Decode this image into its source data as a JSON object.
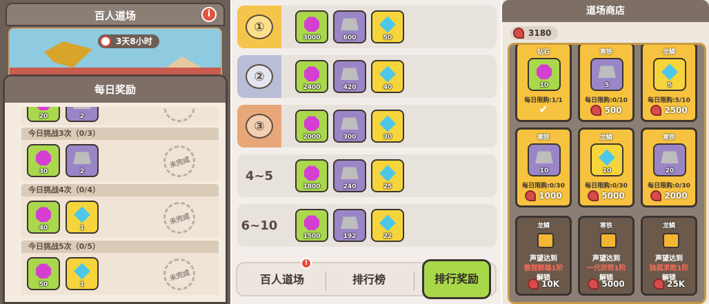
{
  "panel1": {
    "title": "百人道场",
    "info_glyph": "i",
    "timer": "3天8小时",
    "dialog_title": "每日奖励",
    "partial_row": {
      "items": [
        {
          "type": "gem",
          "qty": "20"
        },
        {
          "type": "ingot",
          "qty": "2"
        }
      ]
    },
    "tasks": [
      {
        "label": "今日挑战3次（0/3）",
        "status": "未完成",
        "items": [
          {
            "type": "gem",
            "qty": "30"
          },
          {
            "type": "ingot",
            "qty": "2"
          }
        ]
      },
      {
        "label": "今日挑战4次（0/4）",
        "status": "未完成",
        "items": [
          {
            "type": "gem",
            "qty": "40"
          },
          {
            "type": "scale",
            "qty": "1"
          }
        ]
      },
      {
        "label": "今日挑战5次（0/5）",
        "status": "未完成",
        "items": [
          {
            "type": "gem",
            "qty": "50"
          },
          {
            "type": "scale",
            "qty": "1"
          }
        ]
      }
    ]
  },
  "panel2": {
    "ranks": [
      {
        "rank": "①",
        "badge_color": "#f4c54b",
        "items": [
          "3000",
          "600",
          "50"
        ]
      },
      {
        "rank": "②",
        "badge_color": "#b9bdd6",
        "items": [
          "2400",
          "420",
          "40"
        ]
      },
      {
        "rank": "③",
        "badge_color": "#e7a779",
        "items": [
          "2000",
          "300",
          "30"
        ]
      },
      {
        "rank": "4~5",
        "badge_color": "#e8e2dd",
        "items": [
          "1800",
          "240",
          "25"
        ]
      },
      {
        "rank": "6~10",
        "badge_color": "#e8e2dd",
        "items": [
          "1500",
          "192",
          "22"
        ]
      }
    ],
    "tabs": [
      {
        "label": "百人道场",
        "active": false,
        "alert": "!"
      },
      {
        "label": "排行榜",
        "active": false
      },
      {
        "label": "排行奖励",
        "active": true
      }
    ]
  },
  "panel3": {
    "title": "道场商店",
    "currency": "3180",
    "cards": [
      {
        "name": "钻石",
        "item": "gem",
        "qty": "10",
        "limit": "每日限购:1/1",
        "price": "",
        "sold_out": true
      },
      {
        "name": "寒铁",
        "item": "ingot",
        "qty": "5",
        "limit": "每日限购:0/10",
        "price": "500"
      },
      {
        "name": "龙鳞",
        "item": "scale",
        "qty": "5",
        "limit": "每日限购:5/10",
        "price": "2500"
      },
      {
        "name": "寒铁",
        "item": "ingot",
        "qty": "10",
        "limit": "每日限购:0/30",
        "price": "1000"
      },
      {
        "name": "龙鳞",
        "item": "scale",
        "qty": "10",
        "limit": "每日限购:0/30",
        "price": "5000"
      },
      {
        "name": "寒铁",
        "item": "ingot",
        "qty": "20",
        "limit": "每日限购:0/30",
        "price": "2000"
      },
      {
        "name": "龙鳞",
        "locked": true,
        "req1": "声望达到",
        "req2": "傲视群雄1阶",
        "unlock": "解锁",
        "price": "10K"
      },
      {
        "name": "寒铁",
        "locked": true,
        "req1": "声望达到",
        "req2": "一代宗师1阶",
        "unlock": "解锁",
        "price": "5000"
      },
      {
        "name": "龙鳞",
        "locked": true,
        "req1": "声望达到",
        "req2": "独孤求败1阶",
        "unlock": "解锁",
        "price": "25K"
      }
    ]
  }
}
